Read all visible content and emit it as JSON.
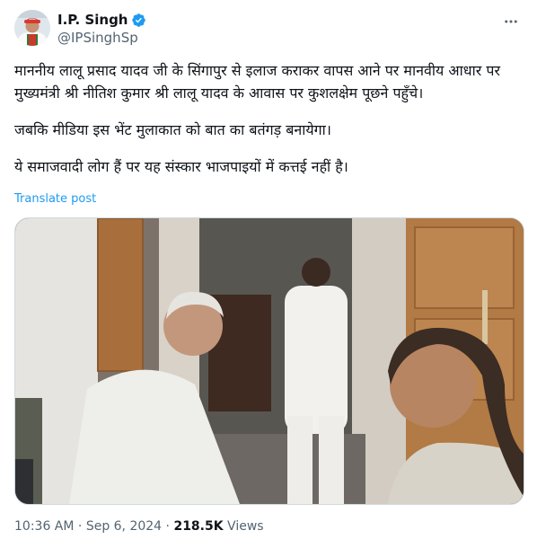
{
  "author": {
    "name": "I.P. Singh",
    "handle": "@IPSinghSp"
  },
  "tweet": {
    "paragraphs": [
      "माननीय लालू प्रसाद यादव जी के सिंगापुर से इलाज कराकर वापस आने पर मानवीय आधार पर मुख्यमंत्री श्री नीतिश कुमार श्री लालू यादव के आवास पर कुशलक्षेम पूछने पहुँचे।",
      "जबकि मीडिया इस भेंट मुलाकात को बात का बतंगड़ बनायेगा।",
      "ये समाजवादी लोग हैं पर यह संस्कार भाजपाइयों में कत्तई नहीं है।"
    ],
    "translate_label": "Translate post"
  },
  "meta": {
    "time": "10:36 AM",
    "sep1": " · ",
    "date": "Sep 6, 2024",
    "sep2": " · ",
    "views_count": "218.5K",
    "views_label": " Views"
  },
  "icons": {
    "verified": "verified-badge-icon",
    "more": "more-options-icon"
  },
  "colors": {
    "link": "#1d9bf0",
    "verified": "#1d9bf0",
    "secondary_text": "#536471"
  }
}
